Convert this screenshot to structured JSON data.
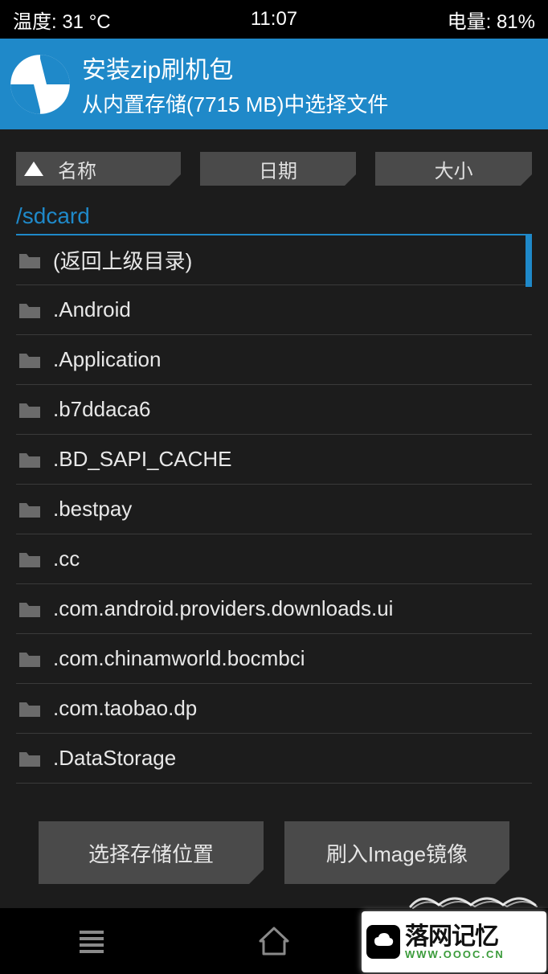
{
  "status": {
    "temp": "温度: 31 °C",
    "time": "11:07",
    "battery": "电量: 81%"
  },
  "header": {
    "title": "安装zip刷机包",
    "subtitle": "从内置存储(7715 MB)中选择文件"
  },
  "sort": {
    "name": "名称",
    "date": "日期",
    "size": "大小"
  },
  "path": "/sdcard",
  "files": [
    "(返回上级目录)",
    ".Android",
    ".Application",
    ".b7ddaca6",
    ".BD_SAPI_CACHE",
    ".bestpay",
    ".cc",
    ".com.android.providers.downloads.ui",
    ".com.chinamworld.bocmbci",
    ".com.taobao.dp",
    ".DataStorage"
  ],
  "buttons": {
    "select_storage": "选择存储位置",
    "flash_image": "刷入Image镜像"
  },
  "watermark": {
    "main": "落网记忆",
    "url": "WWW.OOOC.CN"
  }
}
